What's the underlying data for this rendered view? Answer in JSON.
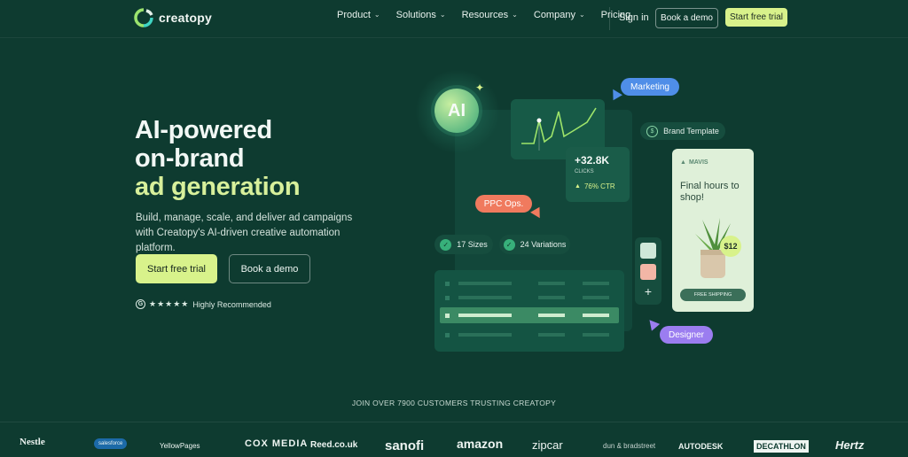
{
  "nav": {
    "logo_text": "creatopy",
    "links": [
      {
        "label": "Product",
        "has_dropdown": true
      },
      {
        "label": "Solutions",
        "has_dropdown": true
      },
      {
        "label": "Resources",
        "has_dropdown": true
      },
      {
        "label": "Company",
        "has_dropdown": true
      },
      {
        "label": "Pricing",
        "has_dropdown": false
      }
    ],
    "signin": "Sign in",
    "book_demo": "Book a demo",
    "start_trial": "Start free trial"
  },
  "hero": {
    "title_line1": "AI-powered",
    "title_line2": "on-brand",
    "title_line3": "ad generation",
    "subtitle": "Build, manage, scale, and deliver ad campaigns with Creatopy's AI-driven creative automation platform.",
    "cta_primary": "Start free trial",
    "cta_secondary": "Book a demo",
    "rating_text": "Highly Recommended",
    "rating_stars": "★★★★★"
  },
  "illustration": {
    "ai_badge": "AI",
    "marketing_tag": "Marketing",
    "brand_template_label": "Brand Template",
    "stat_value": "+32.8K",
    "stat_label": "CLICKS",
    "ctr_value": "76% CTR",
    "ppc_tag": "PPC Ops.",
    "sizes_label": "17 Sizes",
    "variations_label": "24 Variations",
    "designer_tag": "Designer",
    "ad_brand": "MAVIS",
    "ad_headline": "Final hours to shop!",
    "ad_price": "$12",
    "ad_cta": "FREE SHIPPING",
    "add_icon_glyph": "+",
    "colors": {
      "marketing": "#4f8ee8",
      "ppc": "#f07a5e",
      "designer": "#9b7df0",
      "accent_green": "#d8f28b",
      "swatch1": "#cfe8d9",
      "swatch2": "#f2b6a6"
    }
  },
  "customers": {
    "caption": "JOIN OVER 7900 CUSTOMERS TRUSTING CREATOPY",
    "logos": [
      "Nestle",
      "salesforce",
      "YellowPages",
      "COX MEDIA",
      "Reed.co.uk",
      "sanofi",
      "amazon",
      "zipcar",
      "dun & bradstreet",
      "AUTODESK",
      "DECATHLON",
      "Hertz"
    ]
  }
}
